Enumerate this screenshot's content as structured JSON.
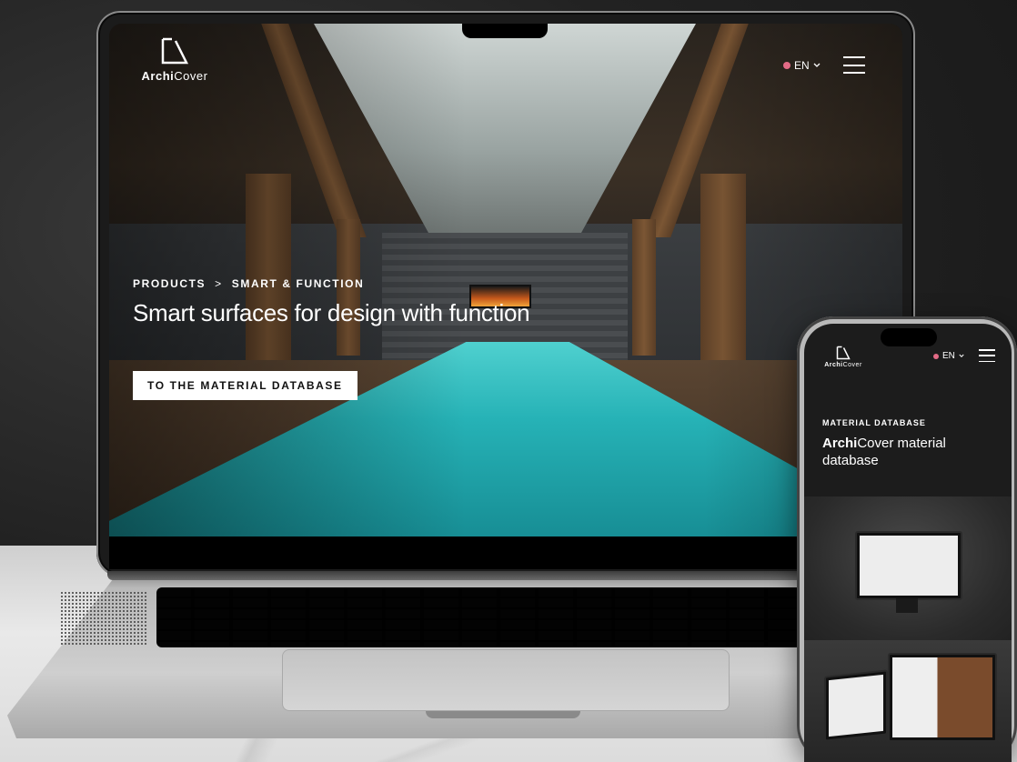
{
  "brand": {
    "name_bold": "Archi",
    "name_rest": "Cover"
  },
  "laptop": {
    "language": "EN",
    "breadcrumb": {
      "parent": "PRODUCTS",
      "separator": ">",
      "current": "SMART & FUNCTION"
    },
    "headline": "Smart surfaces for design with function",
    "cta_label": "TO THE MATERIAL DATABASE"
  },
  "phone": {
    "language": "EN",
    "section_title": "MATERIAL DATABASE",
    "heading_bold": "Archi",
    "heading_rest": "Cover material database"
  },
  "colors": {
    "accent_globe": "#e36b86",
    "cta_bg": "#ffffff",
    "pool": "#26b2b6"
  },
  "icons": [
    "logo-mark-icon",
    "globe-icon",
    "chevron-down-icon",
    "hamburger-menu-icon"
  ]
}
